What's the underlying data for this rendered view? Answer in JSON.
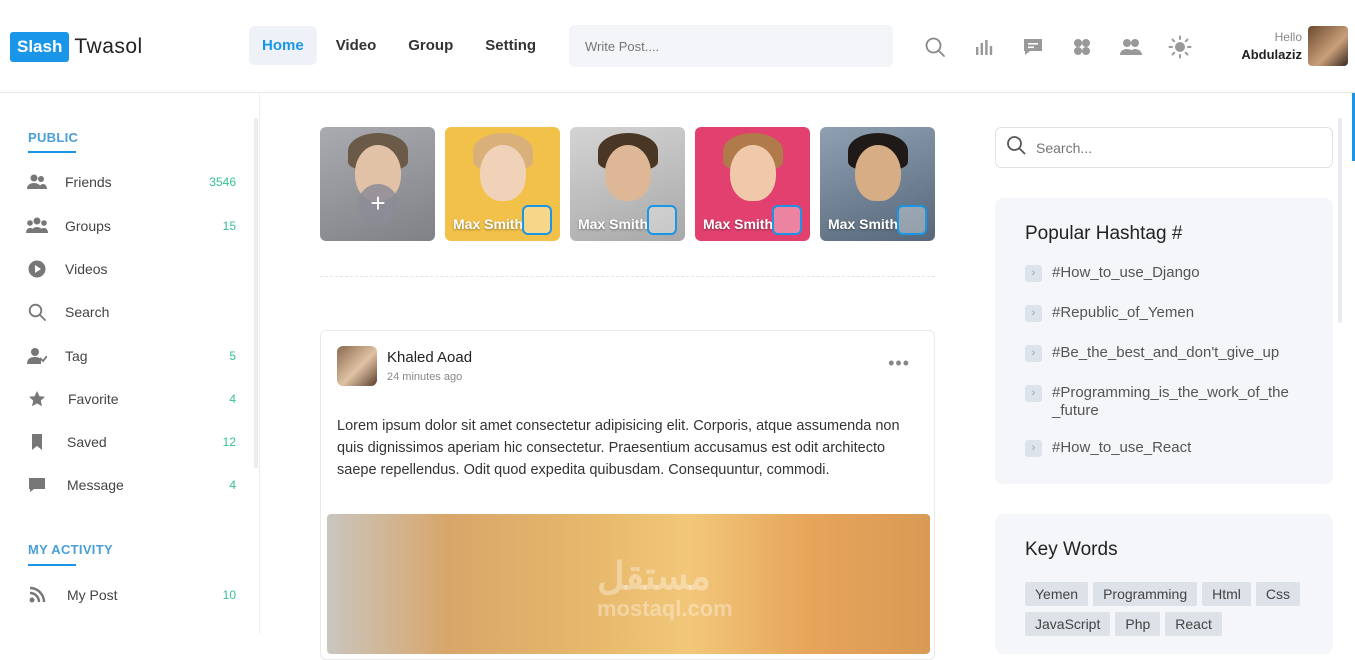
{
  "logo": {
    "box": "Slash",
    "text": "Twasol"
  },
  "nav": [
    {
      "label": "Home",
      "active": true
    },
    {
      "label": "Video",
      "active": false
    },
    {
      "label": "Group",
      "active": false
    },
    {
      "label": "Setting",
      "active": false
    }
  ],
  "post_input": {
    "placeholder": "Write Post...."
  },
  "header_icons": [
    "search-icon",
    "bar-chart-icon",
    "message-icon",
    "apps-icon",
    "users-icon",
    "sun-icon"
  ],
  "user": {
    "greeting": "Hello",
    "name": "Abdulaziz"
  },
  "sidebar": {
    "public_title": "PUBLIC",
    "public_items": [
      {
        "label": "Friends",
        "count": "3546",
        "icon": "friends-icon"
      },
      {
        "label": "Groups",
        "count": "15",
        "icon": "groups-icon"
      },
      {
        "label": "Videos",
        "count": "",
        "icon": "play-icon"
      },
      {
        "label": "Search",
        "count": "",
        "icon": "search-icon"
      },
      {
        "label": "Tag",
        "count": "5",
        "icon": "tag-user-icon"
      },
      {
        "label": "Favorite",
        "count": "4",
        "icon": "star-icon"
      },
      {
        "label": "Saved",
        "count": "12",
        "icon": "bookmark-icon"
      },
      {
        "label": "Message",
        "count": "4",
        "icon": "chat-icon"
      }
    ],
    "activity_title": "MY ACTIVITY",
    "activity_items": [
      {
        "label": "My Post",
        "count": "10",
        "icon": "rss-icon"
      }
    ]
  },
  "stories": [
    {
      "name": "",
      "type": "add",
      "bg": "#8d8f93"
    },
    {
      "name": "Max Smith",
      "type": "story",
      "bg": "#f2c14a"
    },
    {
      "name": "Max Smith",
      "type": "story",
      "bg": "#c9c9c9"
    },
    {
      "name": "Max Smith",
      "type": "story",
      "bg": "#e2416f"
    },
    {
      "name": "Max Smith",
      "type": "story",
      "bg": "#6f8296"
    }
  ],
  "post": {
    "author": "Khaled Aoad",
    "time": "24 minutes ago",
    "more": "•••",
    "body": "Lorem ipsum dolor sit amet consectetur adipisicing elit. Corporis, atque assumenda non quis dignissimos aperiam hic consectetur. Praesentium accusamus est odit architecto saepe repellendus. Odit quod expedita quibusdam. Consequuntur, commodi.",
    "watermark": "مستقل",
    "watermark_sub": "mostaql.com"
  },
  "right_search": {
    "placeholder": "Search..."
  },
  "hashtags": {
    "title": "Popular Hashtag #",
    "items": [
      "#How_to_use_Django",
      "#Republic_of_Yemen",
      "#Be_the_best_and_don't_give_up",
      "#Programming_is_the_work_of_the _future",
      "#How_to_use_React"
    ]
  },
  "keywords": {
    "title": "Key Words",
    "items": [
      "Yemen",
      "Programming",
      "Html",
      "Css",
      "JavaScript",
      "Php",
      "React"
    ]
  },
  "colors": {
    "accent": "#1a96e8",
    "count_green": "#34c38f"
  }
}
